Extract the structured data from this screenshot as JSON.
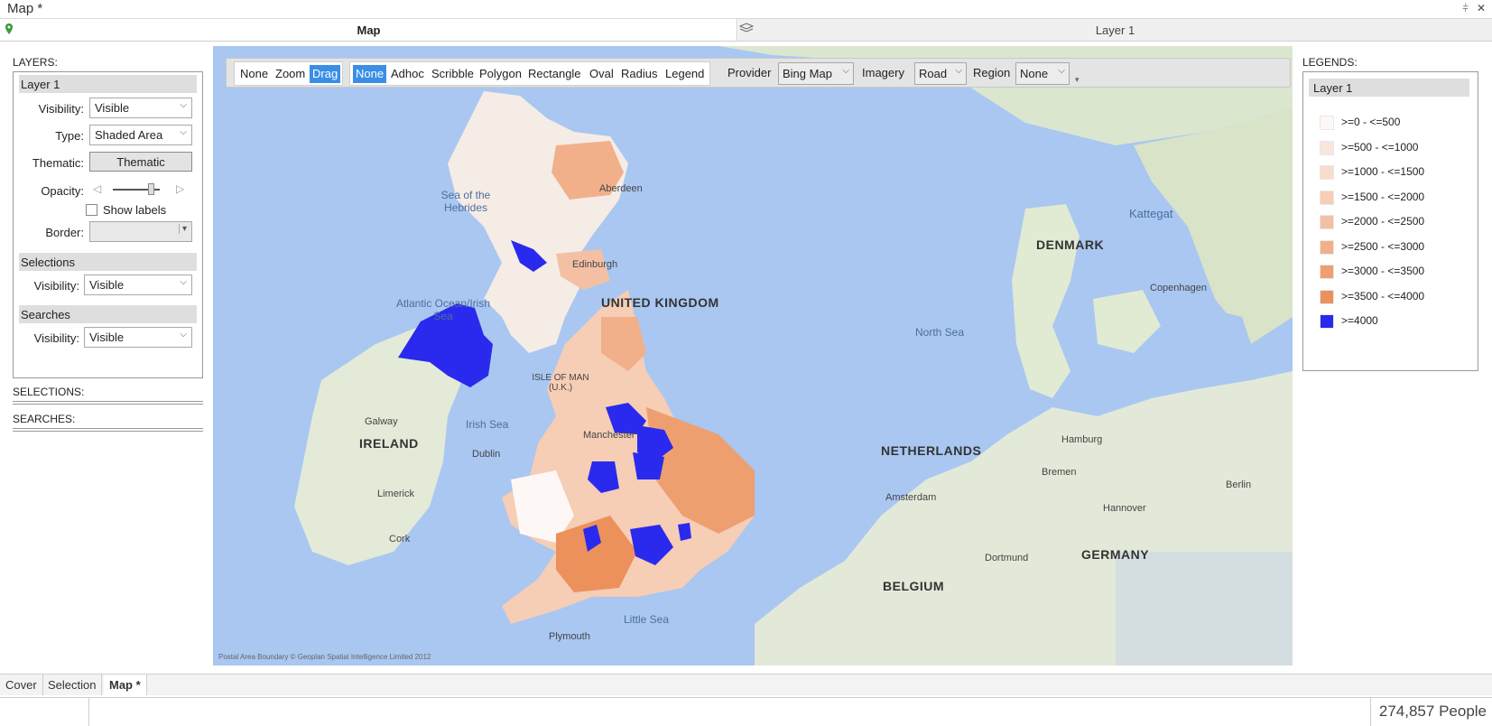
{
  "window": {
    "title": "Map *",
    "pin_label": "↕",
    "close_label": "✕"
  },
  "tabs": {
    "map": "Map",
    "layer": "Layer 1"
  },
  "left_panel": {
    "layers_title": "LAYERS:",
    "layer_name": "Layer 1",
    "visibility_label": "Visibility:",
    "visibility_value": "Visible",
    "type_label": "Type:",
    "type_value": "Shaded Area",
    "thematic_label": "Thematic:",
    "thematic_button": "Thematic",
    "opacity_label": "Opacity:",
    "opacity_level": 0.75,
    "show_labels": "Show labels",
    "border_label": "Border:",
    "border_value": "",
    "selections_header": "Selections",
    "selections_visibility_label": "Visibility:",
    "selections_visibility_value": "Visible",
    "searches_header": "Searches",
    "searches_visibility_label": "Visibility:",
    "searches_visibility_value": "Visible",
    "selections_title": "SELECTIONS:",
    "searches_title": "SEARCHES:"
  },
  "toolbar": {
    "nav": [
      "None",
      "Zoom",
      "Drag"
    ],
    "nav_active": "Drag",
    "select": [
      "None",
      "Adhoc",
      "Scribble",
      "Polygon",
      "Rectangle",
      "Oval",
      "Radius",
      "Legend"
    ],
    "select_active": "None",
    "provider_label": "Provider",
    "provider_value": "Bing Map",
    "imagery_label": "Imagery",
    "imagery_value": "Road",
    "region_label": "Region",
    "region_value": "None"
  },
  "map_labels": {
    "uk": "UNITED KINGDOM",
    "ireland": "IRELAND",
    "denmark": "DENMARK",
    "netherlands": "NETHERLANDS",
    "belgium": "BELGIUM",
    "germany": "GERMANY",
    "north_sea": "North Sea",
    "irish_sea": "Irish Sea",
    "atlantic": "Atlantic Ocean/Irish Sea",
    "hebrides": "Sea of the Hebrides",
    "little_sea": "Little Sea",
    "kattegat": "Kattegat",
    "isle_of_man": "ISLE OF MAN (U.K.)",
    "aberdeen": "Aberdeen",
    "edinburgh": "Edinburgh",
    "manchester": "Manchester",
    "dublin": "Dublin",
    "hamburg": "Hamburg",
    "amsterdam": "Amsterdam",
    "copenhagen": "Copenhagen",
    "berlin": "Berlin",
    "bremen": "Bremen",
    "hannover": "Hannover",
    "dortmund": "Dortmund",
    "cork": "Cork",
    "galway": "Galway",
    "limerick": "Limerick",
    "plymouth": "Plymouth",
    "copyright": "Postal Area Boundary © Geoplan Spatial Intelligence Limited 2012"
  },
  "legends": {
    "title": "LEGENDS:",
    "layer_name": "Layer 1",
    "items": [
      {
        "label": ">=0 - <=500",
        "color": "#fdf8f6"
      },
      {
        "label": ">=500 - <=1000",
        "color": "#fbe6dc"
      },
      {
        "label": ">=1000 - <=1500",
        "color": "#f9dccd"
      },
      {
        "label": ">=1500 - <=2000",
        "color": "#f6cdb5"
      },
      {
        "label": ">=2000 - <=2500",
        "color": "#f4c0a3"
      },
      {
        "label": ">=2500 - <=3000",
        "color": "#f1b08a"
      },
      {
        "label": ">=3000 - <=3500",
        "color": "#ee9f6f"
      },
      {
        "label": ">=3500 - <=4000",
        "color": "#ec915c"
      },
      {
        "label": ">=4000",
        "color": "#2a2aee"
      }
    ]
  },
  "bottom_tabs": [
    "Cover",
    "Selection",
    "Map *"
  ],
  "bottom_active": "Map *",
  "status": {
    "people": "274,857 People"
  }
}
